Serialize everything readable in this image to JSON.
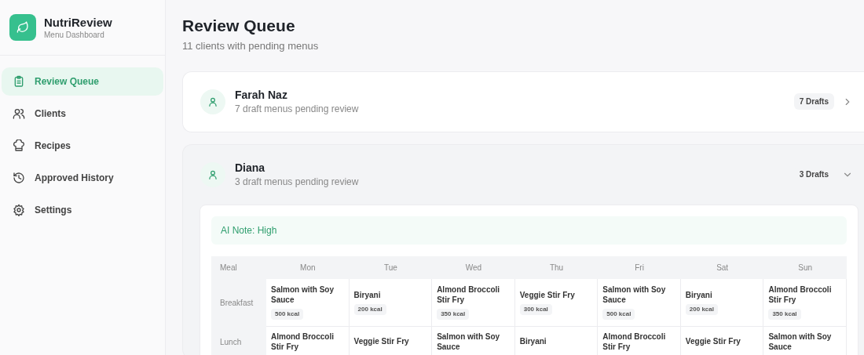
{
  "app": {
    "name": "NutriReview",
    "subtitle": "Menu Dashboard"
  },
  "sidebar": {
    "items": [
      {
        "label": "Review Queue",
        "selected": true
      },
      {
        "label": "Clients",
        "selected": false
      },
      {
        "label": "Recipes",
        "selected": false
      },
      {
        "label": "Approved History",
        "selected": false
      },
      {
        "label": "Settings",
        "selected": false
      }
    ]
  },
  "page": {
    "title": "Review Queue",
    "subtitle": "11 clients with pending menus"
  },
  "clients": [
    {
      "name": "Farah Naz",
      "summary": "7 draft menus pending review",
      "badge": "7 Drafts",
      "expanded": false
    },
    {
      "name": "Diana",
      "summary": "3 draft menus pending review",
      "badge": "3 Drafts",
      "expanded": true,
      "ai_note": "AI Note: High",
      "table": {
        "columns": [
          "Meal",
          "Mon",
          "Tue",
          "Wed",
          "Thu",
          "Fri",
          "Sat",
          "Sun"
        ],
        "rows": [
          {
            "cells": [
              {
                "kind": "meal",
                "text": "Breakfast"
              },
              {
                "kind": "dish",
                "text": "Salmon with Soy Sauce",
                "kcal": "500 kcal"
              },
              {
                "kind": "dish",
                "text": "Biryani",
                "kcal": "200 kcal"
              },
              {
                "kind": "dish",
                "text": "Almond Broccoli Stir Fry",
                "kcal": "350 kcal"
              },
              {
                "kind": "dish",
                "text": "Veggie Stir Fry",
                "kcal": "300 kcal"
              },
              {
                "kind": "dish",
                "text": "Salmon with Soy Sauce",
                "kcal": "500 kcal"
              },
              {
                "kind": "dish",
                "text": "Biryani",
                "kcal": "200 kcal"
              },
              {
                "kind": "dish",
                "text": "Almond Broccoli Stir Fry",
                "kcal": "350 kcal"
              }
            ]
          },
          {
            "cells": [
              {
                "kind": "meal",
                "text": "Lunch"
              },
              {
                "kind": "dish",
                "text": "Almond Broccoli Stir Fry"
              },
              {
                "kind": "dish",
                "text": "Veggie Stir Fry"
              },
              {
                "kind": "dish",
                "text": "Salmon with Soy Sauce"
              },
              {
                "kind": "dish",
                "text": "Biryani"
              },
              {
                "kind": "dish",
                "text": "Almond Broccoli Stir Fry"
              },
              {
                "kind": "dish",
                "text": "Veggie Stir Fry"
              },
              {
                "kind": "dish",
                "text": "Salmon with Soy Sauce"
              }
            ]
          }
        ]
      }
    }
  ]
}
